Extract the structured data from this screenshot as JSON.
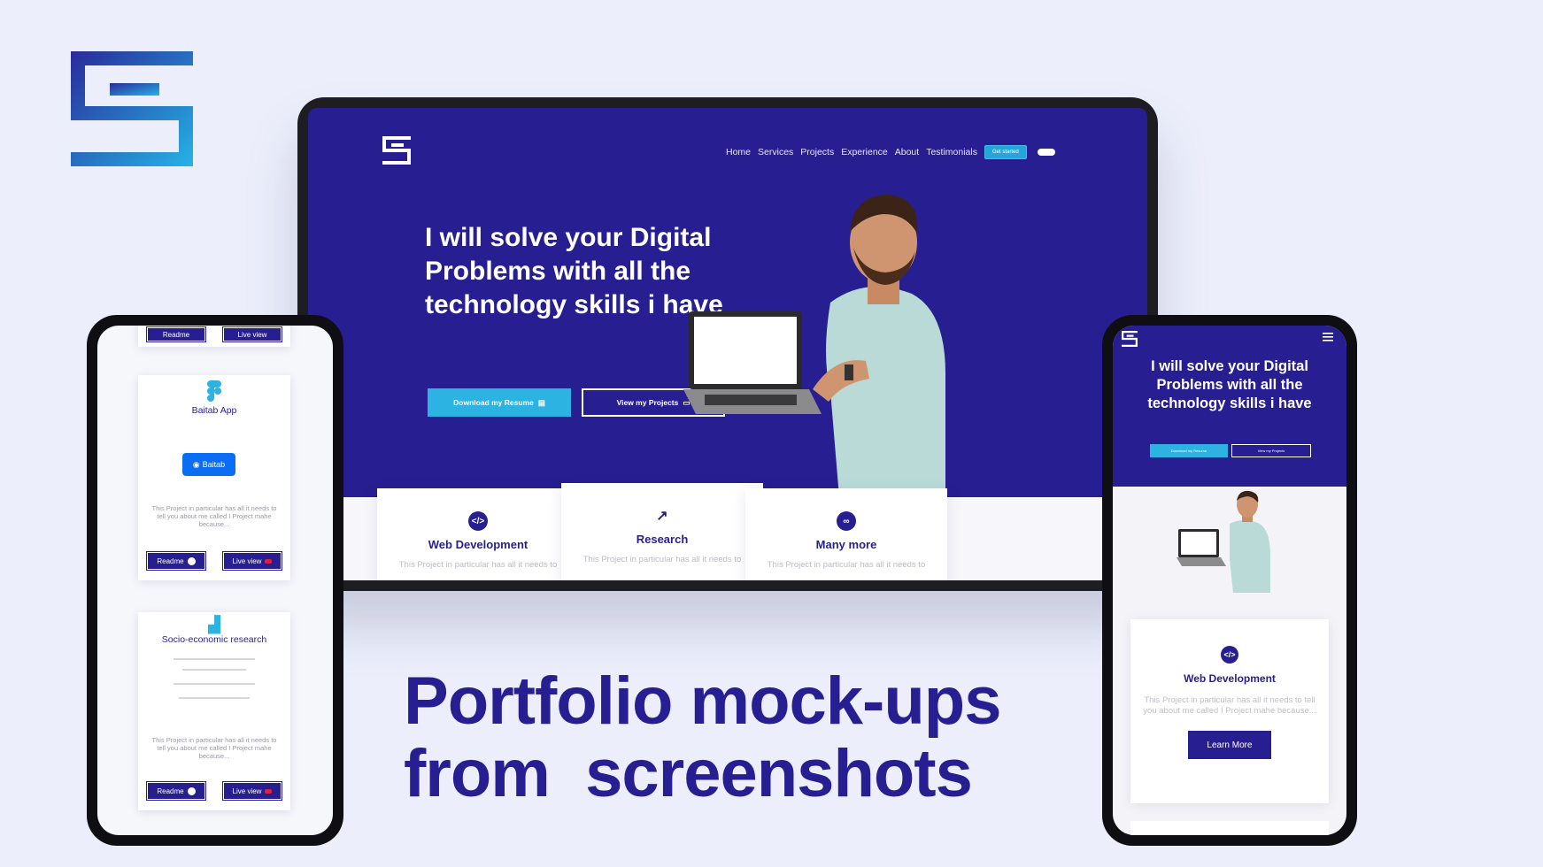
{
  "headline": {
    "line1": "Portfolio mock-ups",
    "line2": "from  screenshots"
  },
  "desktop": {
    "nav": [
      "Home",
      "Services",
      "Projects",
      "Experience",
      "About",
      "Testimonials"
    ],
    "get_started": "Get started",
    "hero_title": "I will solve your Digital Problems with all the technology  skills i have",
    "btn_resume": "Download my Resume",
    "btn_projects": "View my Projects",
    "services": [
      {
        "title": "Web Development",
        "icon": "code-icon",
        "desc": "This Project in particular has all it needs to"
      },
      {
        "title": "Research",
        "icon": "chart-icon",
        "desc": "This Project in particular has all it needs to"
      },
      {
        "title": "Many more",
        "icon": "infinity-icon",
        "desc": "This Project in particular has all it needs to"
      }
    ]
  },
  "phone_left": {
    "projects": [
      {
        "title": "Baitab App",
        "badge": "Baitab",
        "desc": "This Project in particular has all it needs to tell you about me called I Project mahe because...",
        "readme": "Readme",
        "live": "Live view"
      },
      {
        "title": "Socio-economic research",
        "desc": "This Project in particular has all it needs to tell you about me called I Project mahe because...",
        "readme": "Readme",
        "live": "Live view"
      }
    ],
    "top_readme": "Readme",
    "top_live": "Live view"
  },
  "phone_right": {
    "hero_title": "I will solve your Digital Problems with all the technology  skills i have",
    "btn_resume": "Download my Resume",
    "btn_projects": "View my Projects",
    "card_title": "Web Development",
    "card_desc": "This Project in particular has all it needs to tell you about me called I Project mahe because...",
    "learn_more": "Learn More"
  },
  "colors": {
    "brand_navy": "#271f91",
    "accent_cyan": "#2cb3e2",
    "background": "#eceffb"
  }
}
